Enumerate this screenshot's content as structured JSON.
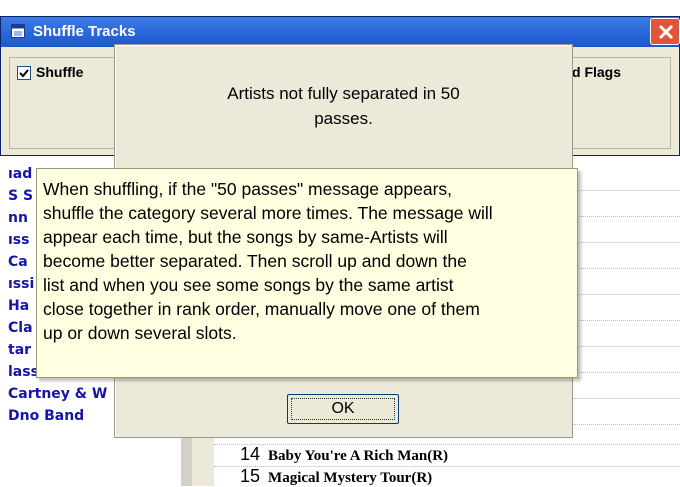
{
  "shuffle_dialog": {
    "title": "Shuffle Tracks",
    "shuffle_checkbox_label": "Shuffle",
    "flags_label": "d Flags"
  },
  "message": {
    "line1": "Artists not fully separated in  50",
    "line2": "passes.",
    "ok_label": "OK"
  },
  "tooltip": {
    "text": "When shuffling, if the \"50 passes\" message appears,\nshuffle the category several more times. The message will\nappear each time, but the songs by same-Artists will\nbecome better separated.  Then scroll up and down the\nlist and when you see some songs by the same artist\nclose together in rank order, manually move one of them\nup or down several slots."
  },
  "left_list": [
    "ıad",
    "S S",
    "nn",
    "ıss",
    "Ca",
    "ıssi",
    "Ha",
    "Cla",
    "tar",
    "lassics",
    "Cartney & W",
    "Dno Band"
  ],
  "tracks": [
    {
      "num": "14",
      "title": "Baby You're A Rich Man(R)"
    },
    {
      "num": "15",
      "title": "Magical Mystery Tour(R)"
    }
  ]
}
